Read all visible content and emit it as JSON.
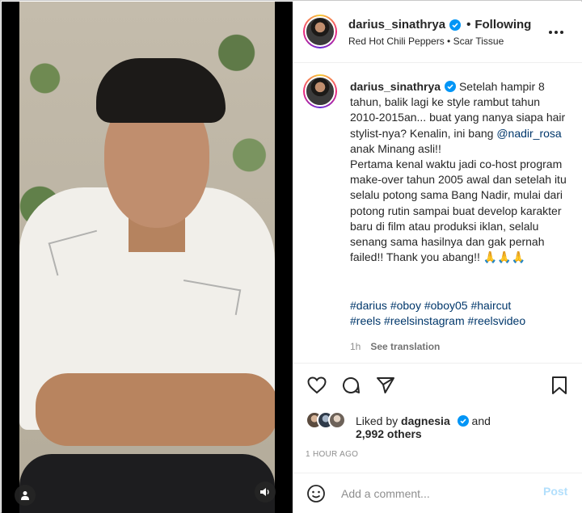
{
  "colors": {
    "link": "#00376b",
    "verified": "#0095f6",
    "post_disabled": "#b2dffc",
    "muted": "#8e8e8e"
  },
  "header": {
    "username": "darius_sinathrya",
    "separator": "•",
    "follow_status": "Following",
    "audio": "Red Hot Chili Peppers • Scar Tissue",
    "more_icon": "more-horizontal-icon"
  },
  "caption": {
    "username": "darius_sinathrya",
    "text_before": " Setelah hampir 8 tahun, balik lagi ke style rambut tahun 2010-2015an... buat yang nanya siapa hair stylist-nya? Kenalin, ini bang ",
    "mention": "@nadir_rosa",
    "text_after": " anak Minang asli!!\nPertama kenal waktu jadi co-host program make-over tahun 2005 awal dan setelah itu selalu potong sama Bang Nadir, mulai dari potong rutin sampai buat develop karakter baru di film atau produksi iklan, selalu senang sama hasilnya dan gak pernah failed!! Thank you abang!! 🙏🙏🙏",
    "hashtags": [
      "#darius",
      "#oboy",
      "#oboy05",
      "#haircut",
      "#reels",
      "#reelsinstagram",
      "#reelsvideo"
    ],
    "age": "1h",
    "see_translation": "See translation"
  },
  "actions": {
    "like_icon": "heart-icon",
    "comment_icon": "comment-icon",
    "share_icon": "share-icon",
    "save_icon": "bookmark-icon"
  },
  "likes": {
    "prefix": "Liked by",
    "user": "dagnesia",
    "conjunction": "and",
    "others": "2,992 others"
  },
  "timestamp": "1 HOUR AGO",
  "comment_box": {
    "placeholder": "Add a comment...",
    "post_label": "Post",
    "emoji_icon": "emoji-icon"
  }
}
